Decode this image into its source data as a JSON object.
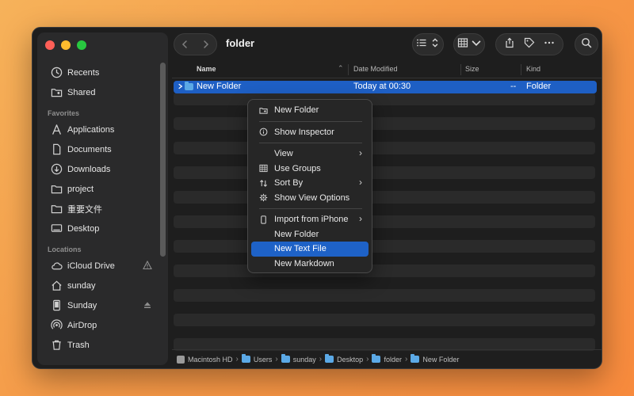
{
  "window": {
    "title": "folder"
  },
  "sidebar": {
    "top_items": [
      {
        "label": "Recents",
        "icon": "clock-icon"
      },
      {
        "label": "Shared",
        "icon": "shared-folder-icon"
      }
    ],
    "favorites_title": "Favorites",
    "favorites": [
      {
        "label": "Applications",
        "icon": "applications-icon"
      },
      {
        "label": "Documents",
        "icon": "document-icon"
      },
      {
        "label": "Downloads",
        "icon": "download-icon"
      },
      {
        "label": "project",
        "icon": "folder-icon"
      },
      {
        "label": "重要文件",
        "icon": "folder-icon"
      },
      {
        "label": "Desktop",
        "icon": "desktop-icon"
      }
    ],
    "locations_title": "Locations",
    "locations": [
      {
        "label": "iCloud Drive",
        "icon": "cloud-icon",
        "right_icon": "warning-icon"
      },
      {
        "label": "sunday",
        "icon": "home-icon"
      },
      {
        "label": "Sunday",
        "icon": "drive-icon",
        "right_icon": "eject-icon"
      },
      {
        "label": "AirDrop",
        "icon": "airdrop-icon"
      },
      {
        "label": "Trash",
        "icon": "trash-icon"
      }
    ]
  },
  "toolbar": {
    "back_icon": "chevron-left-icon",
    "forward_icon": "chevron-right-icon",
    "view_list_icon": "list-view-icon",
    "group_icon": "grid-group-icon",
    "share_icon": "share-icon",
    "tag_icon": "tag-icon",
    "more_icon": "ellipsis-icon",
    "search_icon": "search-icon"
  },
  "columns": {
    "name": "Name",
    "date": "Date Modified",
    "size": "Size",
    "kind": "Kind"
  },
  "selected_row": {
    "name": "New Folder",
    "date": "Today at 00:30",
    "size": "--",
    "kind": "Folder"
  },
  "context_menu": {
    "items": [
      {
        "label": "New Folder",
        "icon": "new-folder-icon"
      },
      {
        "label": "Show Inspector",
        "icon": "info-icon"
      },
      {
        "label": "View",
        "submenu": true
      },
      {
        "label": "Use Groups",
        "icon": "grid-icon"
      },
      {
        "label": "Sort By",
        "icon": "sort-icon",
        "submenu": true
      },
      {
        "label": "Show View Options",
        "icon": "gear-icon"
      },
      {
        "label": "Import from iPhone",
        "icon": "iphone-icon",
        "submenu": true
      },
      {
        "label": "New Folder"
      },
      {
        "label": "New Text File",
        "highlighted": true
      },
      {
        "label": "New Markdown"
      }
    ]
  },
  "pathbar": {
    "crumbs": [
      "Macintosh HD",
      "Users",
      "sunday",
      "Desktop",
      "folder",
      "New Folder"
    ]
  },
  "colors": {
    "accent": "#1e5fc4",
    "window_bg": "#1e1e1e",
    "sidebar_bg": "#2a2a2b",
    "folder": "#5ba9e6"
  }
}
